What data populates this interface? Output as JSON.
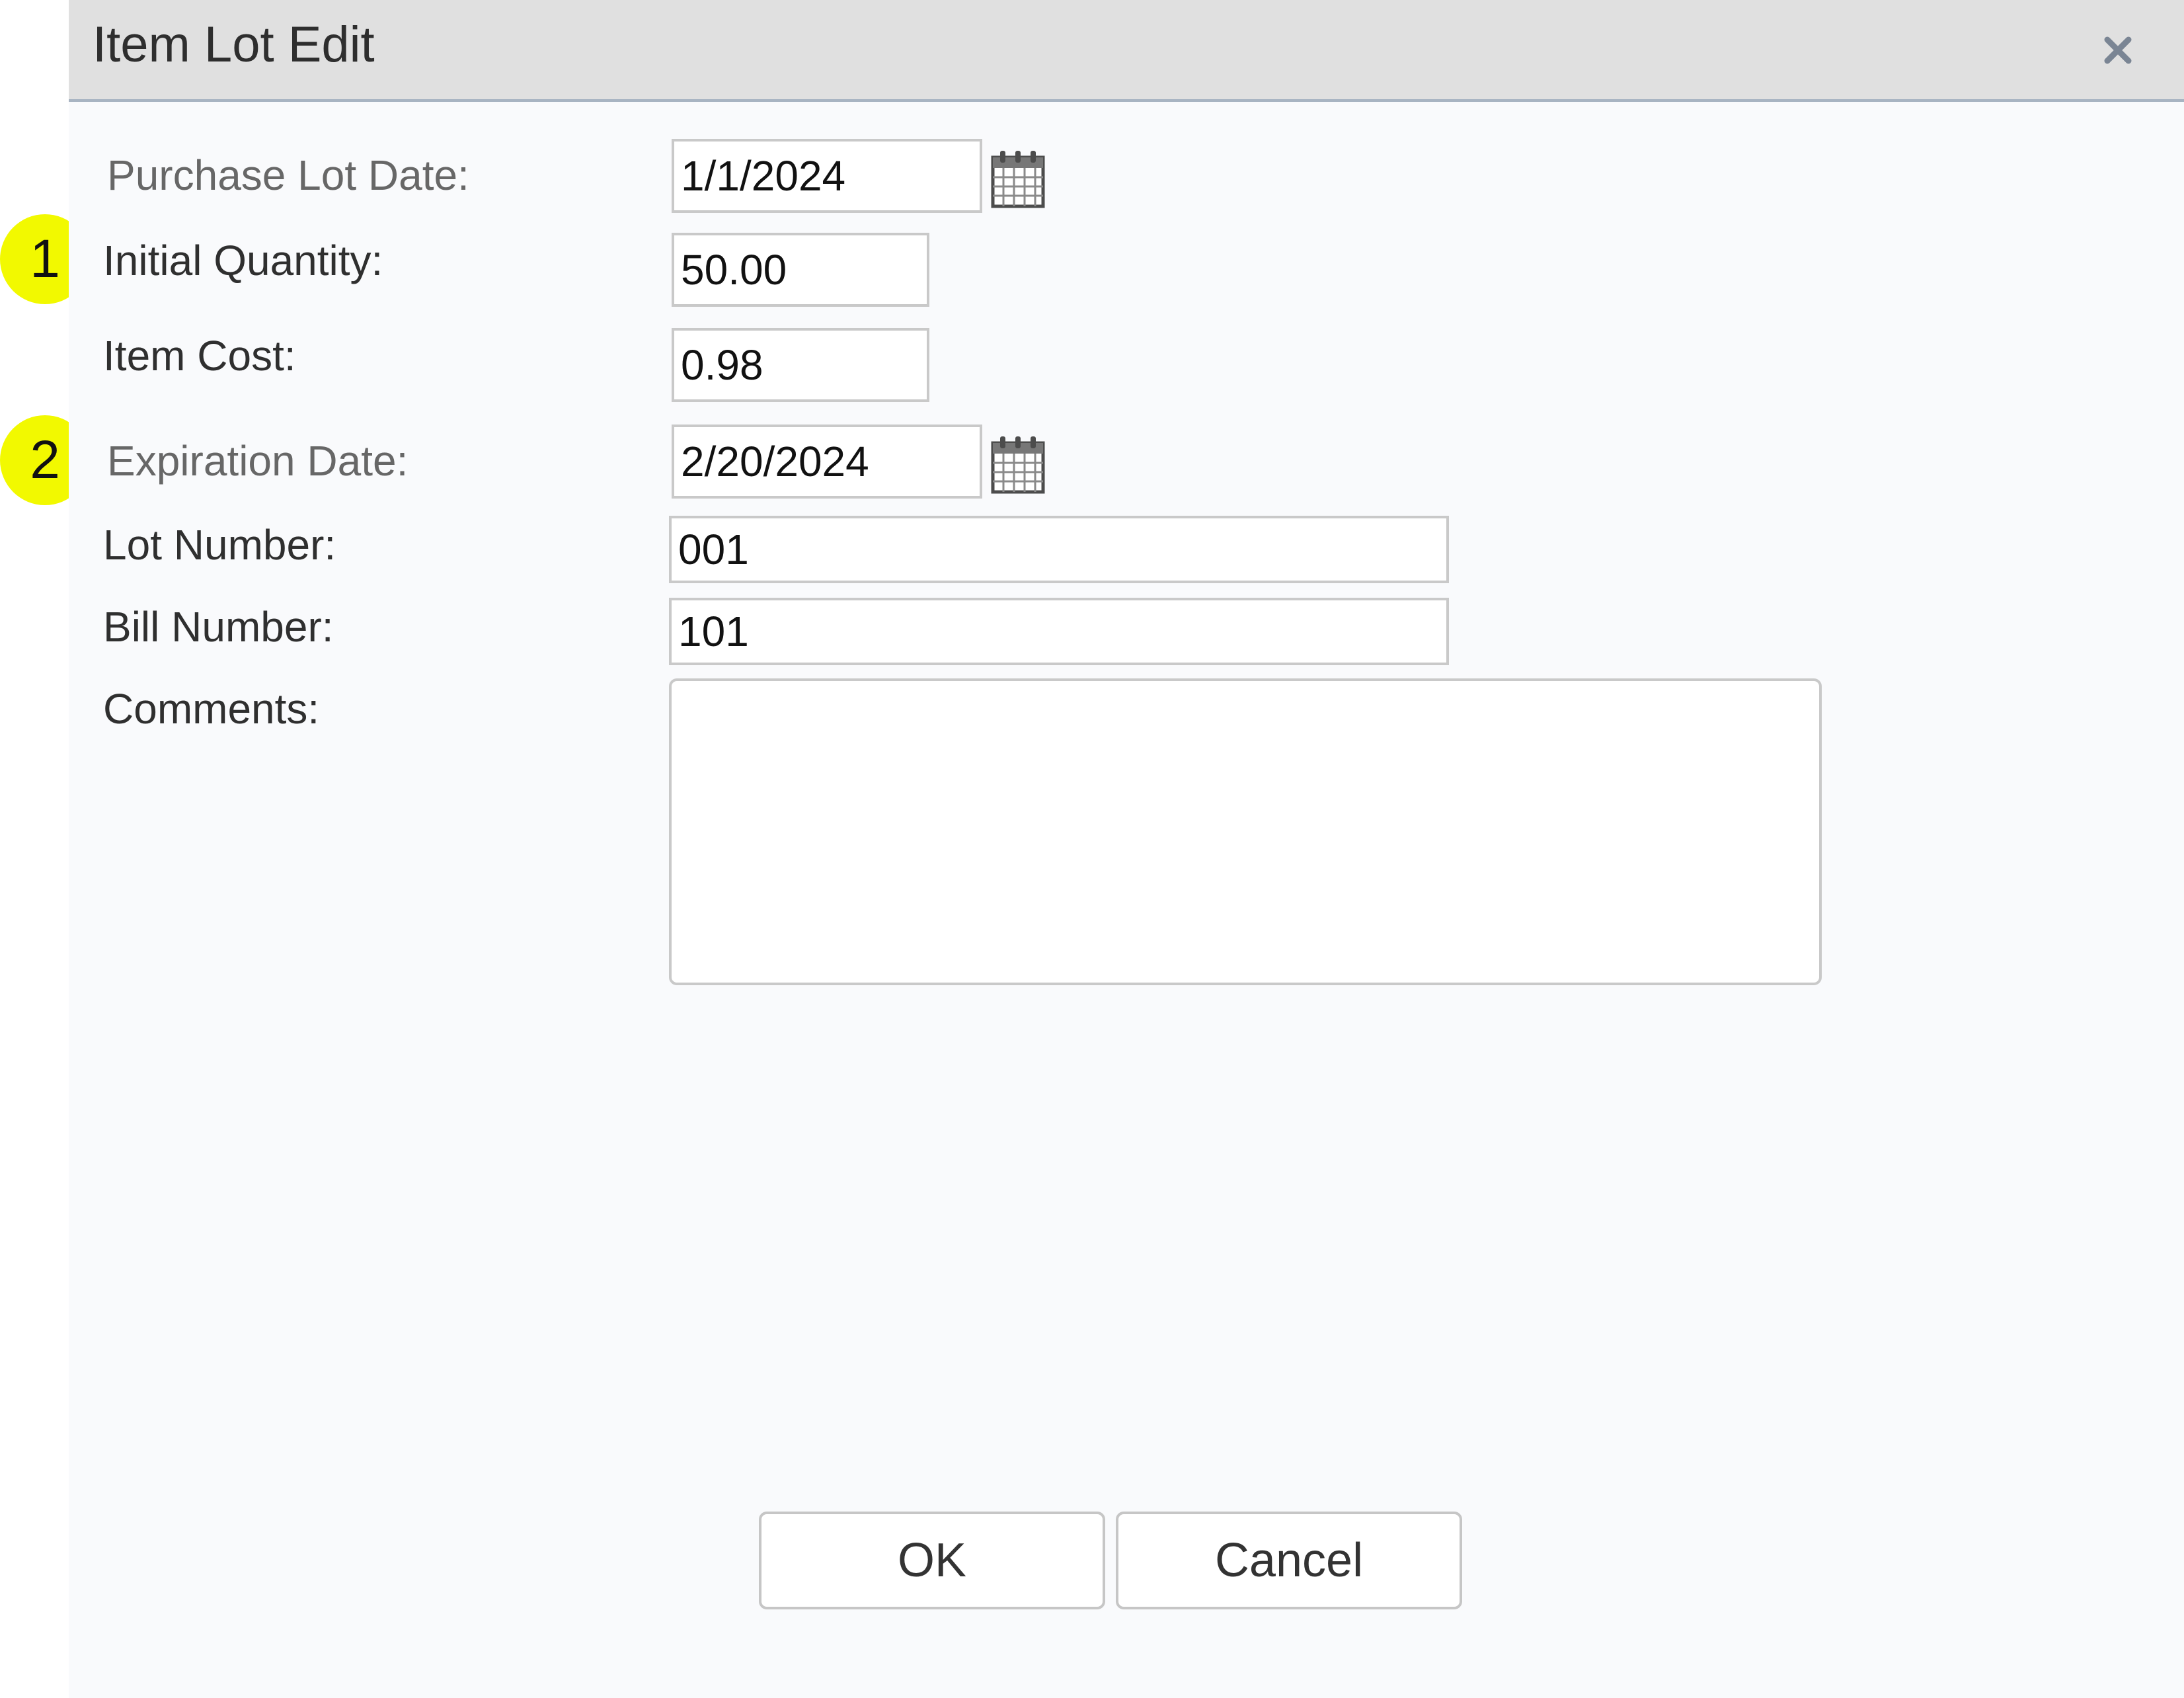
{
  "dialog": {
    "title": "Item Lot Edit",
    "close_icon": "close-icon"
  },
  "form": {
    "purchase_lot_date": {
      "label": "Purchase Lot Date:",
      "value": "1/1/2024"
    },
    "initial_quantity": {
      "label": "Initial Quantity:",
      "value": "50.00"
    },
    "item_cost": {
      "label": "Item Cost:",
      "value": "0.98"
    },
    "expiration_date": {
      "label": "Expiration Date:",
      "value": "2/20/2024"
    },
    "lot_number": {
      "label": "Lot Number:",
      "value": "001"
    },
    "bill_number": {
      "label": "Bill Number:",
      "value": "101"
    },
    "comments": {
      "label": "Comments:",
      "value": ""
    }
  },
  "annotations": [
    {
      "number": "1",
      "target": "initial_quantity"
    },
    {
      "number": "2",
      "target": "expiration_date"
    }
  ],
  "buttons": {
    "ok_label": "OK",
    "cancel_label": "Cancel"
  },
  "colors": {
    "badge": "#f2f900",
    "titlebar": "#e0e0e0",
    "dialog_bg": "#f9fafc"
  },
  "icons": [
    "close-icon",
    "calendar-icon"
  ]
}
